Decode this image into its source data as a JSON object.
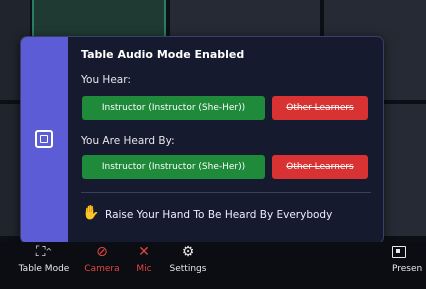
{
  "popup": {
    "title": "Table Audio Mode Enabled",
    "you_hear_label": "You Hear:",
    "you_hear_allowed": "Instructor (Instructor (She-Her))",
    "you_hear_blocked": "Other Learners",
    "heard_by_label": "You Are Heard By:",
    "heard_by_allowed": "Instructor (Instructor (She-Her))",
    "heard_by_blocked": "Other Learners",
    "raise_hand_text": "Raise Your Hand To Be Heard By Everybody",
    "raise_hand_icon": "✋"
  },
  "toolbar": {
    "table_mode": "Table Mode",
    "camera": "Camera",
    "mic": "Mic",
    "settings": "Settings",
    "present": "Presen"
  },
  "colors": {
    "accent": "#5b5cd6",
    "allowed": "#1f8a3a",
    "blocked": "#d83232",
    "muted_red": "#e2453f"
  }
}
